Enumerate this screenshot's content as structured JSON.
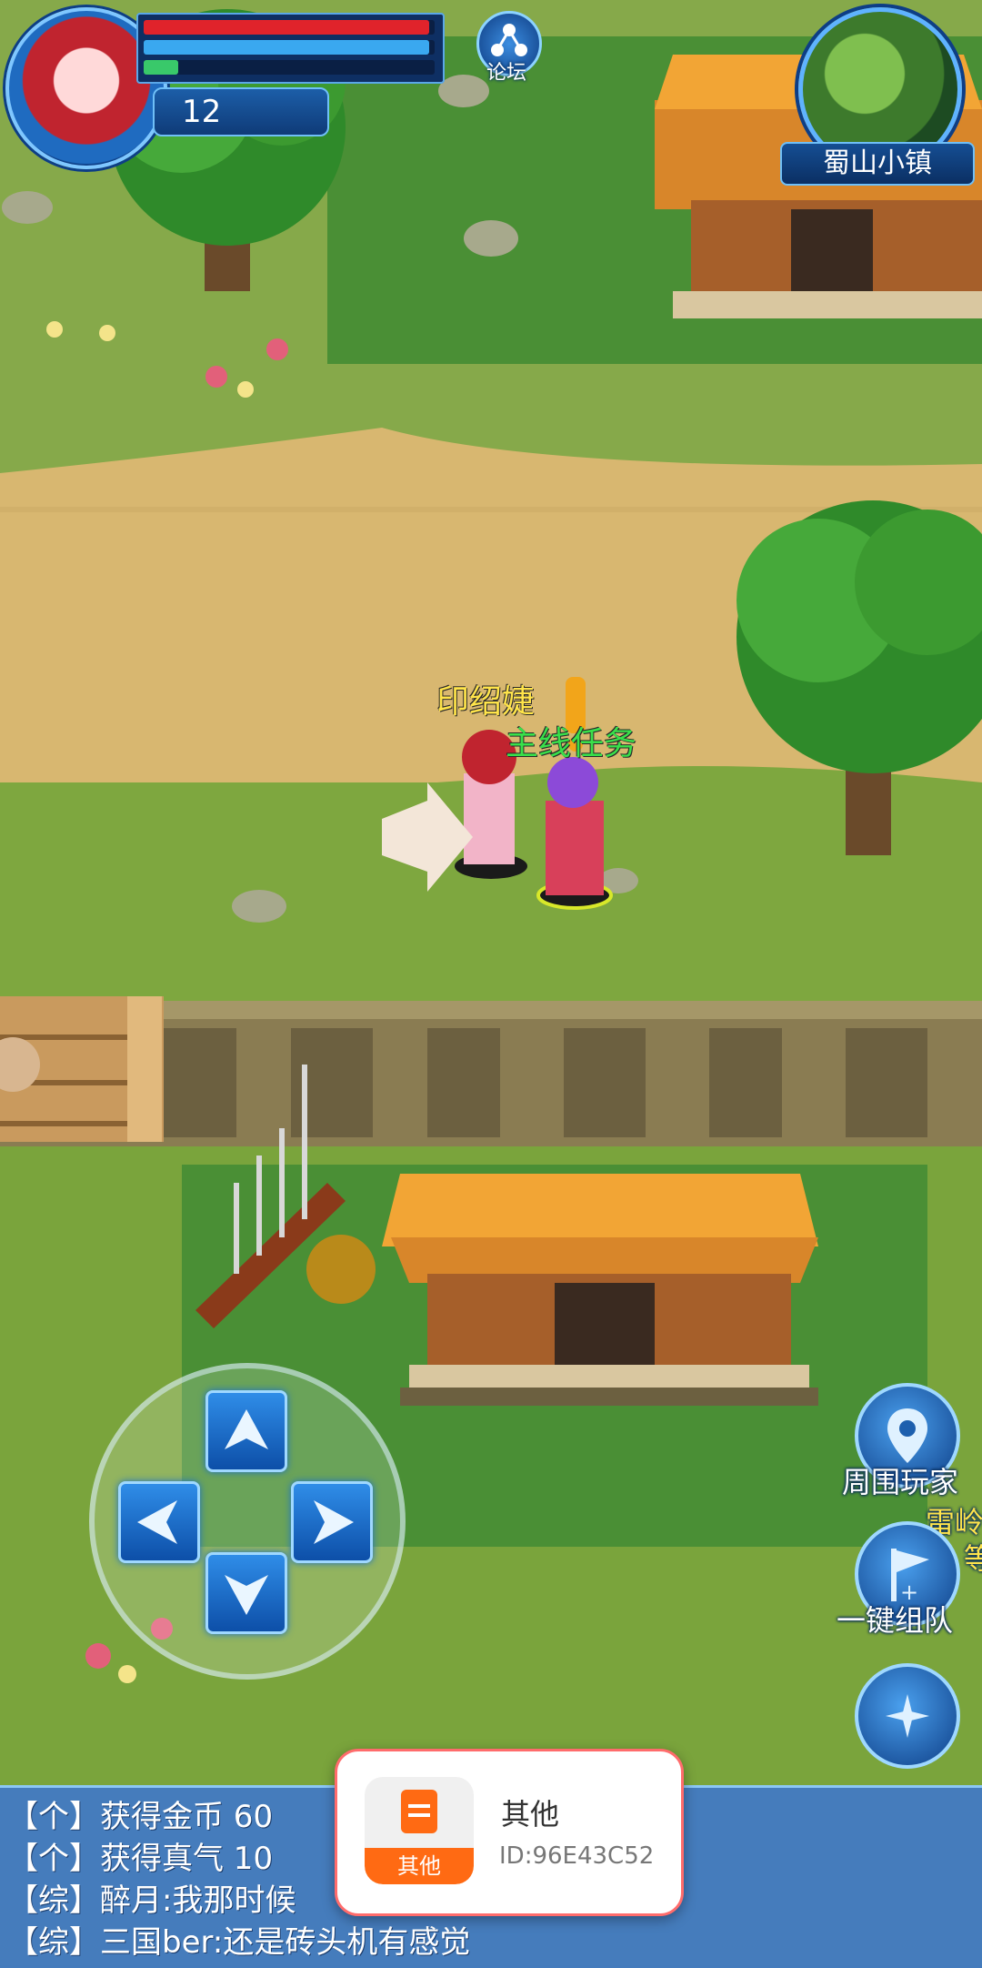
{
  "hud": {
    "level": "12",
    "hp_fraction": 0.98,
    "mp_fraction": 0.98,
    "exp_fraction": 0.12,
    "forum_label": "论坛",
    "map_name": "蜀山小镇"
  },
  "characters": {
    "player_name": "印绍婕",
    "npc_tag": "主线任务"
  },
  "right_buttons": {
    "nearby_label": "周围玩家",
    "team_label": "一键组队",
    "edge_text_1": "雷岭",
    "edge_text_2": "等"
  },
  "chat": {
    "lines": [
      "【个】获得金币 60",
      "【个】获得真气 10",
      "【综】醉月:我那时候",
      "【综】三国ber:还是砖头机有感觉"
    ]
  },
  "notification": {
    "icon_tag": "其他",
    "title": "其他",
    "id_text": "ID:96E43C52"
  },
  "colors": {
    "hp": "#e0232b",
    "mp": "#3aa8f0",
    "exp": "#39c96a",
    "name_yellow": "#ffe44a",
    "quest_green": "#39e04a",
    "notif_accent": "#ff6a13"
  }
}
